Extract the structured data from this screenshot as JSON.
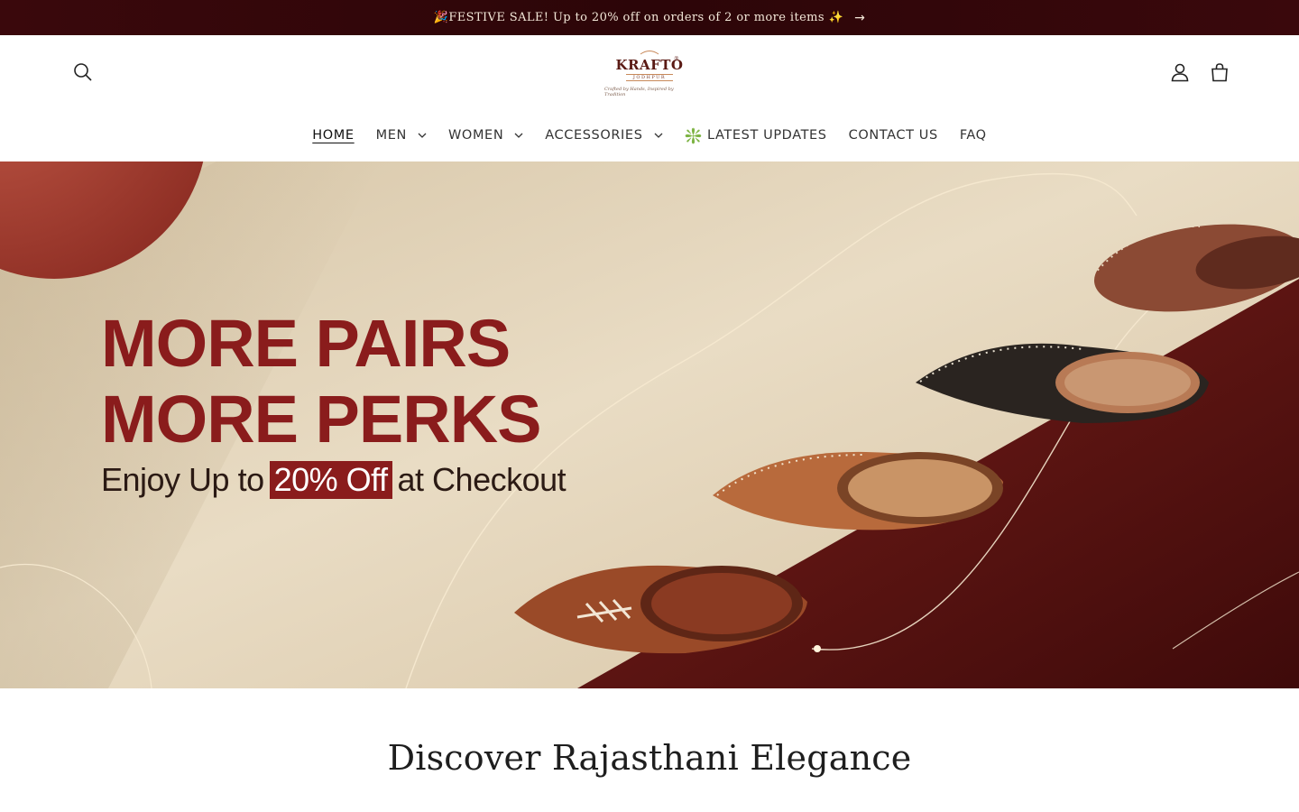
{
  "announcement": {
    "text": "🎉FESTIVE SALE! Up to 20% off on orders of 2 or more items ✨",
    "arrow": "→"
  },
  "header": {
    "logo": {
      "name": "KRAFTO",
      "city": "JODHPUR",
      "tagline": "Crafted by Hands, Inspired by Tradition"
    },
    "icons": {
      "search": "search-icon",
      "account": "account-icon",
      "cart": "cart-icon"
    }
  },
  "nav": {
    "items": [
      {
        "label": "HOME",
        "dropdown": false,
        "active": true
      },
      {
        "label": "MEN",
        "dropdown": true
      },
      {
        "label": "WOMEN",
        "dropdown": true
      },
      {
        "label": "ACCESSORIES",
        "dropdown": true
      },
      {
        "label": "LATEST UPDATES",
        "prefix": "❇️",
        "dropdown": false
      },
      {
        "label": "CONTACT US",
        "dropdown": false
      },
      {
        "label": "FAQ",
        "dropdown": false
      }
    ]
  },
  "hero": {
    "line1": "MORE PAIRS",
    "line2": "MORE PERKS",
    "sub_before": "Enjoy Up to",
    "sub_highlight": "20% Off",
    "sub_after": "at Checkout"
  },
  "section": {
    "title": "Discover Rajasthani Elegance"
  },
  "colors": {
    "brand_maroon": "#8a1c1c",
    "announcement_bg": "#2c0508",
    "hero_beige": "#e6d7bd"
  }
}
